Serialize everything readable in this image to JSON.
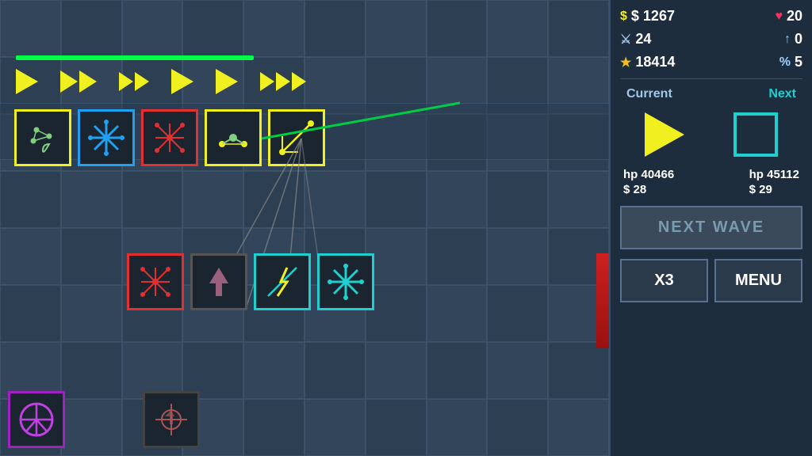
{
  "stats": {
    "money": "$ 1267",
    "hearts": "20",
    "sword": "24",
    "arrow_up": "0",
    "star": "18414",
    "percent": "5",
    "money_icon": "$",
    "heart_icon": "♥",
    "sword_icon": "⚔",
    "star_icon": "★",
    "percent_icon": "%"
  },
  "current_next": {
    "current_label": "Current",
    "next_label": "Next",
    "current_hp": "hp 40466",
    "current_cost": "$ 28",
    "next_hp": "hp 45112",
    "next_cost": "$ 29"
  },
  "buttons": {
    "next_wave": "NEXT WAVE",
    "x3": "X3",
    "menu": "MENU"
  }
}
